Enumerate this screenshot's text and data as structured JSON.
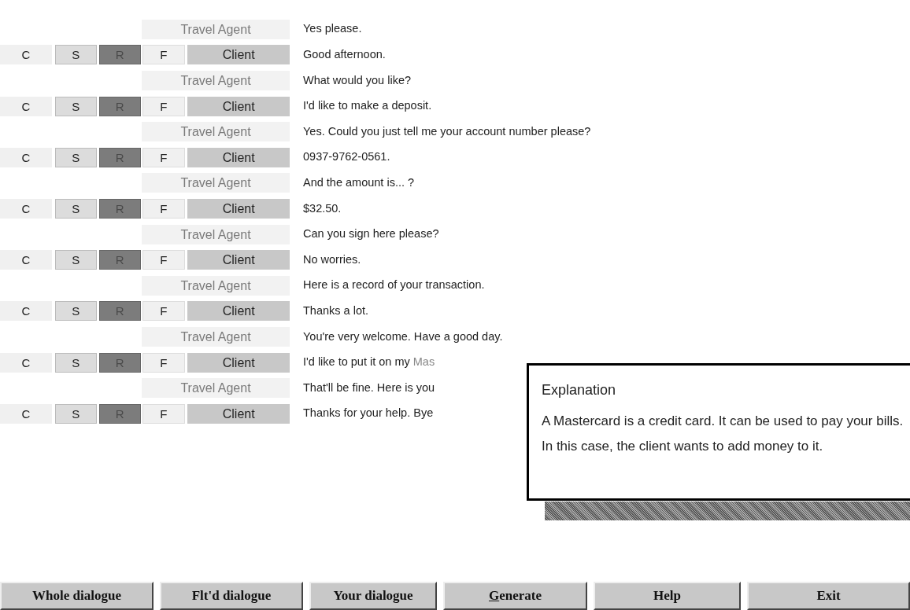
{
  "dialogue": [
    {
      "kind": "agent",
      "speaker": "Travel Agent",
      "text": "Yes please."
    },
    {
      "kind": "client",
      "controls": [
        {
          "label": "C",
          "selected": false
        },
        {
          "label": "S",
          "selected": false
        },
        {
          "label": "R",
          "selected": true
        },
        {
          "label": "F",
          "selected": false
        }
      ],
      "speaker": "Client",
      "text": "Good afternoon."
    },
    {
      "kind": "agent",
      "speaker": "Travel Agent",
      "text": "What would you like?"
    },
    {
      "kind": "client",
      "controls": [
        {
          "label": "C",
          "selected": false
        },
        {
          "label": "S",
          "selected": false
        },
        {
          "label": "R",
          "selected": true
        },
        {
          "label": "F",
          "selected": false
        }
      ],
      "speaker": "Client",
      "text": "I'd like to make a deposit."
    },
    {
      "kind": "agent",
      "speaker": "Travel Agent",
      "text": "Yes. Could you just tell me your account number please?"
    },
    {
      "kind": "client",
      "controls": [
        {
          "label": "C",
          "selected": false
        },
        {
          "label": "S",
          "selected": false
        },
        {
          "label": "R",
          "selected": true
        },
        {
          "label": "F",
          "selected": false
        }
      ],
      "speaker": "Client",
      "text": "0937-9762-0561."
    },
    {
      "kind": "agent",
      "speaker": "Travel Agent",
      "text": "And the amount is... ?"
    },
    {
      "kind": "client",
      "controls": [
        {
          "label": "C",
          "selected": false
        },
        {
          "label": "S",
          "selected": false
        },
        {
          "label": "R",
          "selected": true
        },
        {
          "label": "F",
          "selected": false
        }
      ],
      "speaker": "Client",
      "text": "$32.50."
    },
    {
      "kind": "agent",
      "speaker": "Travel Agent",
      "text": "Can you sign here please?"
    },
    {
      "kind": "client",
      "controls": [
        {
          "label": "C",
          "selected": false
        },
        {
          "label": "S",
          "selected": false
        },
        {
          "label": "R",
          "selected": true
        },
        {
          "label": "F",
          "selected": false
        }
      ],
      "speaker": "Client",
      "text": "No worries."
    },
    {
      "kind": "agent",
      "speaker": "Travel Agent",
      "text": "Here is a record of your transaction."
    },
    {
      "kind": "client",
      "controls": [
        {
          "label": "C",
          "selected": false
        },
        {
          "label": "S",
          "selected": false
        },
        {
          "label": "R",
          "selected": true
        },
        {
          "label": "F",
          "selected": false
        }
      ],
      "speaker": "Client",
      "text": "Thanks a lot."
    },
    {
      "kind": "agent",
      "speaker": "Travel Agent",
      "text": "You're very welcome. Have a good day."
    },
    {
      "kind": "client",
      "controls": [
        {
          "label": "C",
          "selected": false
        },
        {
          "label": "S",
          "selected": false
        },
        {
          "label": "R",
          "selected": true
        },
        {
          "label": "F",
          "selected": false
        }
      ],
      "speaker": "Client",
      "text": "I'd like to put it on my ",
      "term": "Mas"
    },
    {
      "kind": "agent",
      "speaker": "Travel Agent",
      "text": "That'll be fine. Here is you"
    },
    {
      "kind": "client",
      "controls": [
        {
          "label": "C",
          "selected": false
        },
        {
          "label": "S",
          "selected": false
        },
        {
          "label": "R",
          "selected": true
        },
        {
          "label": "F",
          "selected": false
        }
      ],
      "speaker": "Client",
      "text": "Thanks for your help. Bye"
    }
  ],
  "explanation": {
    "title": "Explanation",
    "body": "A Mastercard is a credit card. It can be used to pay your bills. In this case, the client wants to add money to it."
  },
  "buttons": [
    {
      "label": "Whole dialogue",
      "mnemonic": false
    },
    {
      "label": "Flt'd dialogue",
      "mnemonic": false
    },
    {
      "label": "Your dialogue",
      "mnemonic": false
    },
    {
      "label": "Generate",
      "mnemonic": true
    },
    {
      "label": "Help",
      "mnemonic": false
    },
    {
      "label": "Exit",
      "mnemonic": false
    }
  ]
}
